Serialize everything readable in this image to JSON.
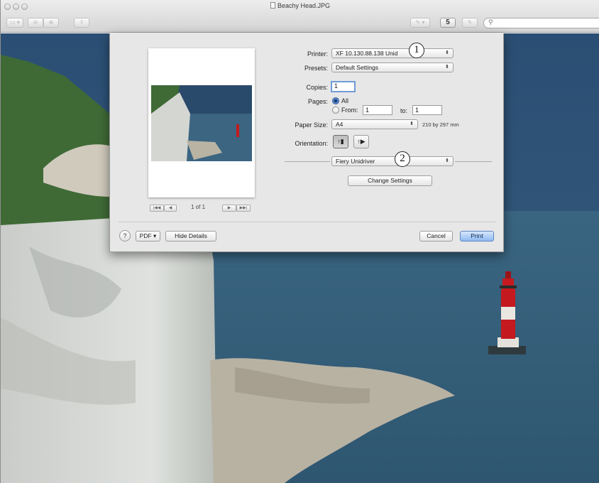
{
  "window": {
    "title": "Beachy Head.JPG"
  },
  "toolbar": {
    "share_label": "5",
    "search_placeholder": ""
  },
  "print_dialog": {
    "printer_label": "Printer:",
    "printer_value": "XF 10.130.88.138 Unid",
    "presets_label": "Presets:",
    "presets_value": "Default Settings",
    "copies_label": "Copies:",
    "copies_value": "1",
    "pages_label": "Pages:",
    "pages_all": "All",
    "pages_from": "From:",
    "pages_from_value": "1",
    "pages_to": "to:",
    "pages_to_value": "1",
    "paper_size_label": "Paper Size:",
    "paper_size_value": "A4",
    "paper_size_dims": "210 by 297 mm",
    "orientation_label": "Orientation:",
    "section_popup_value": "Fiery Unidriver",
    "change_settings_label": "Change Settings",
    "preview_page_count": "1 of 1",
    "help_label": "?",
    "pdf_label": "PDF ▾",
    "hide_details_label": "Hide Details",
    "cancel_label": "Cancel",
    "print_label": "Print"
  },
  "callouts": {
    "one": "1",
    "two": "2"
  },
  "colors": {
    "sky": "#27496a",
    "sea": "#3a6079",
    "accent_blue": "#8fbaf0",
    "lighthouse_red": "#c41a1f"
  }
}
